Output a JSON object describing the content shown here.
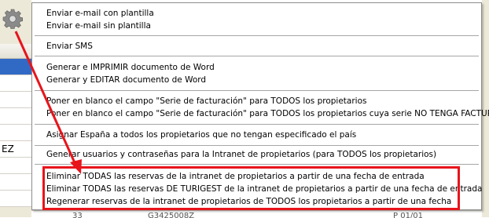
{
  "background": {
    "rows": [
      "",
      "",
      "",
      "",
      "",
      "",
      "",
      "",
      "EZ",
      "",
      ""
    ],
    "bottom_row": [
      "33",
      "G3425008Z",
      "P 01/01"
    ]
  },
  "menu": {
    "groups": [
      [
        "Enviar e-mail con plantilla",
        "Enviar e-mail sin plantilla"
      ],
      [
        "Enviar SMS"
      ],
      [
        "Generar e IMPRIMIR documento de Word",
        "Generar y EDITAR documento de Word"
      ],
      [
        "Poner en blanco el campo \"Serie de facturación\" para TODOS los propietarios",
        "Poner en blanco el campo \"Serie de facturación\" para TODOS los propietarios cuya serie NO TENGA FACTURAS"
      ],
      [
        "Asignar España a todos los propietarios que no tengan especificado el país"
      ],
      [
        "Generar usuarios y contraseñas para la Intranet de propietarios (para TODOS los propietarios)"
      ],
      [
        "Eliminar TODAS las reservas de la intranet de propietarios a partir de una fecha de entrada",
        "Eliminar TODAS las reservas DE TURIGEST de la intranet de propietarios a partir de una fecha de entrada",
        "Regenerar reservas de la intranet de propietarios de TODOS los propietarios a partir de una fecha"
      ]
    ]
  },
  "colors": {
    "annotation": "#e8141b",
    "selection": "#316ac5"
  },
  "icons": {
    "toolbar": "gear-icon"
  }
}
